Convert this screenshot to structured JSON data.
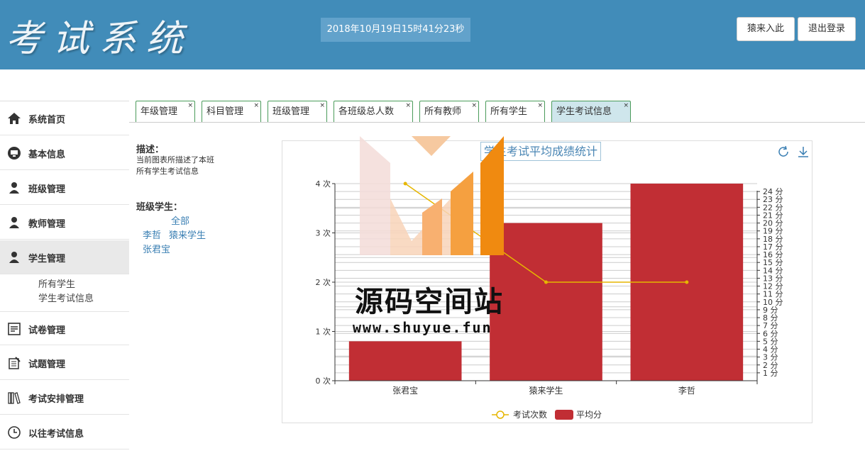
{
  "header": {
    "logo": "考试系统",
    "datetime": "2018年10月19日15时41分23秒",
    "btn_primary": "猿来入此",
    "btn_logout": "退出登录"
  },
  "sidebar": {
    "items": [
      {
        "label": "系统首页",
        "icon": "home-icon"
      },
      {
        "label": "基本信息",
        "icon": "monitor-icon"
      },
      {
        "label": "班级管理",
        "icon": "user-icon"
      },
      {
        "label": "教师管理",
        "icon": "user-icon"
      },
      {
        "label": "学生管理",
        "icon": "user-icon"
      },
      {
        "label": "试卷管理",
        "icon": "paper-icon"
      },
      {
        "label": "试题管理",
        "icon": "question-icon"
      },
      {
        "label": "考试安排管理",
        "icon": "books-icon"
      },
      {
        "label": "以往考试信息",
        "icon": "clock-icon"
      }
    ],
    "sub_items": [
      "所有学生",
      "学生考试信息"
    ]
  },
  "tabs": [
    "年级管理",
    "科目管理",
    "班级管理",
    "各班级总人数",
    "所有教师",
    "所有学生",
    "学生考试信息"
  ],
  "tab_close": "×",
  "panel": {
    "desc_heading": "描述：",
    "desc_text": "当前图表所描述了本班 所有学生考试信息",
    "class_heading": "班级学生：",
    "links": [
      "全部",
      "李哲",
      "猿来学生",
      "张君宝"
    ]
  },
  "watermark": {
    "text": "源码空间站",
    "url": "www.shuyue.fun"
  },
  "colors": {
    "header_bg": "#418cb9",
    "bar": "#c12e34",
    "line": "#e6b600",
    "tab_active": "#cfe6ec"
  },
  "chart_data": {
    "type": "bar",
    "title": "学生考试平均成绩统计",
    "categories": [
      "张君宝",
      "猿来学生",
      "李哲"
    ],
    "series": [
      {
        "name": "平均分",
        "type": "bar",
        "axis": "right",
        "values": [
          5,
          20,
          25
        ]
      },
      {
        "name": "考试次数",
        "type": "line",
        "axis": "left",
        "values": [
          4,
          2,
          2
        ]
      }
    ],
    "y_left": {
      "min": 0,
      "max": 4,
      "ticks": [
        "0 次",
        "1 次",
        "2 次",
        "3 次",
        "4 次"
      ]
    },
    "y_right": {
      "min": 0,
      "max": 25,
      "ticks": [
        "1 分",
        "2 分",
        "3 分",
        "4 分",
        "5 分",
        "6 分",
        "7 分",
        "8 分",
        "9 分",
        "10 分",
        "11 分",
        "12 分",
        "13 分",
        "14 分",
        "15 分",
        "16 分",
        "17 分",
        "18 分",
        "19 分",
        "20 分",
        "21 分",
        "22 分",
        "23 分",
        "24 分"
      ]
    },
    "legend": [
      "考试次数",
      "平均分"
    ],
    "legend_position": "bottom",
    "grid": true
  }
}
